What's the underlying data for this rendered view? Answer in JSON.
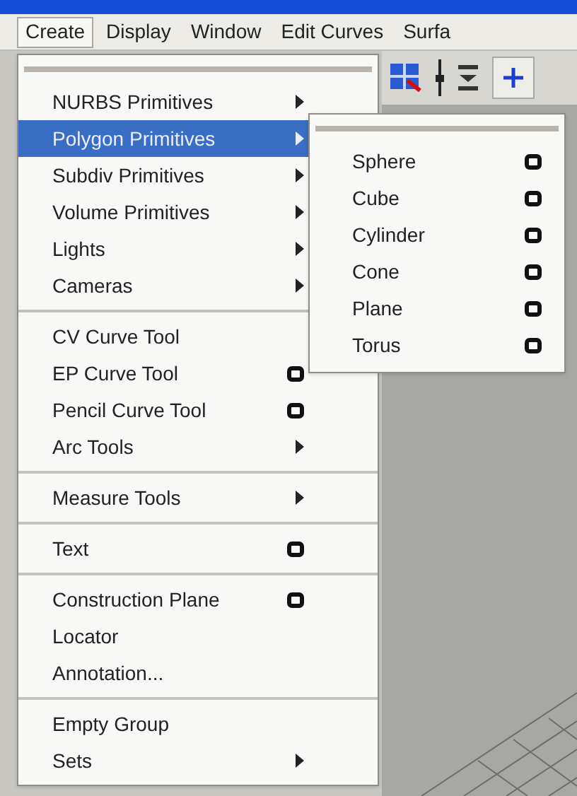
{
  "menubar": [
    {
      "label": "Create",
      "selected": true
    },
    {
      "label": "Display",
      "selected": false
    },
    {
      "label": "Window",
      "selected": false
    },
    {
      "label": "Edit Curves",
      "selected": false
    },
    {
      "label": "Surfa",
      "selected": false
    }
  ],
  "menu": {
    "groups": [
      [
        {
          "label": "NURBS Primitives",
          "has_submenu": true,
          "has_options": false,
          "selected": false
        },
        {
          "label": "Polygon Primitives",
          "has_submenu": true,
          "has_options": false,
          "selected": true
        },
        {
          "label": "Subdiv Primitives",
          "has_submenu": true,
          "has_options": false,
          "selected": false
        },
        {
          "label": "Volume Primitives",
          "has_submenu": true,
          "has_options": false,
          "selected": false
        },
        {
          "label": "Lights",
          "has_submenu": true,
          "has_options": false,
          "selected": false
        },
        {
          "label": "Cameras",
          "has_submenu": true,
          "has_options": false,
          "selected": false
        }
      ],
      [
        {
          "label": "CV Curve Tool",
          "has_submenu": false,
          "has_options": false,
          "selected": false
        },
        {
          "label": "EP Curve Tool",
          "has_submenu": false,
          "has_options": true,
          "selected": false
        },
        {
          "label": "Pencil Curve Tool",
          "has_submenu": false,
          "has_options": true,
          "selected": false
        },
        {
          "label": "Arc Tools",
          "has_submenu": true,
          "has_options": false,
          "selected": false
        }
      ],
      [
        {
          "label": "Measure Tools",
          "has_submenu": true,
          "has_options": false,
          "selected": false
        }
      ],
      [
        {
          "label": "Text",
          "has_submenu": false,
          "has_options": true,
          "selected": false
        }
      ],
      [
        {
          "label": "Construction Plane",
          "has_submenu": false,
          "has_options": true,
          "selected": false
        },
        {
          "label": "Locator",
          "has_submenu": false,
          "has_options": false,
          "selected": false
        },
        {
          "label": "Annotation...",
          "has_submenu": false,
          "has_options": false,
          "selected": false
        }
      ],
      [
        {
          "label": "Empty Group",
          "has_submenu": false,
          "has_options": false,
          "selected": false
        },
        {
          "label": "Sets",
          "has_submenu": true,
          "has_options": false,
          "selected": false
        }
      ]
    ]
  },
  "submenu": {
    "items": [
      {
        "label": "Sphere",
        "has_options": true
      },
      {
        "label": "Cube",
        "has_options": true
      },
      {
        "label": "Cylinder",
        "has_options": true
      },
      {
        "label": "Cone",
        "has_options": true
      },
      {
        "label": "Plane",
        "has_options": true
      },
      {
        "label": "Torus",
        "has_options": true
      }
    ]
  }
}
